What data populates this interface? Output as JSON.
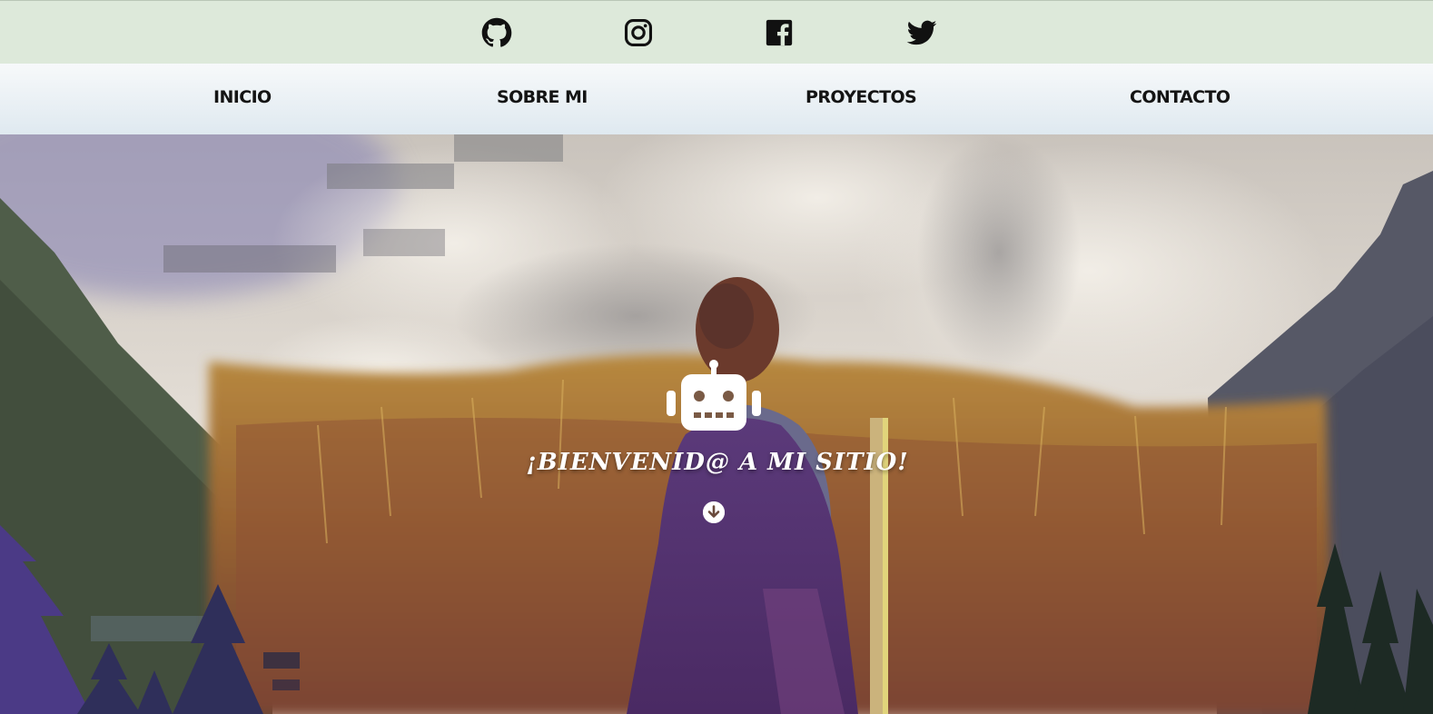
{
  "social": {
    "links": [
      {
        "name": "github",
        "icon": "github-icon"
      },
      {
        "name": "instagram",
        "icon": "instagram-icon"
      },
      {
        "name": "facebook",
        "icon": "facebook-icon"
      },
      {
        "name": "twitter",
        "icon": "twitter-icon"
      }
    ]
  },
  "nav": {
    "items": [
      {
        "label": "INICIO"
      },
      {
        "label": "SOBRE MI"
      },
      {
        "label": "PROYECTOS"
      },
      {
        "label": "CONTACTO"
      }
    ]
  },
  "hero": {
    "icon": "robot-icon",
    "title": "¡BIENVENID@ A MI SITIO!",
    "scroll_icon": "arrow-circle-down-icon"
  },
  "colors": {
    "social_bar_bg": "#dde9da",
    "nav_gradient_top": "#f7f9fa",
    "nav_gradient_bottom": "#dfe9f0",
    "nav_text": "#141414",
    "hero_text": "#ffffff"
  }
}
